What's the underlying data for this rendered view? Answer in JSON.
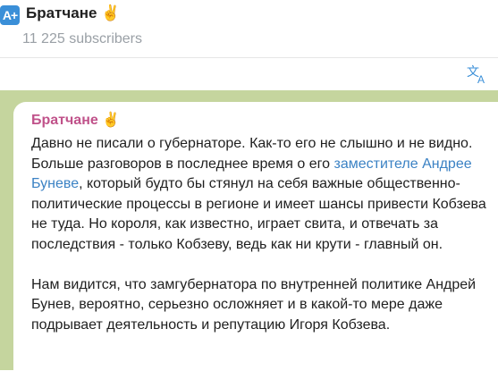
{
  "header": {
    "avatar_text": "A+",
    "channel_title": "Братчане",
    "title_emoji": "✌️",
    "subscribers": "11 225 subscribers"
  },
  "toolbar": {
    "translate_icon": "translate-icon"
  },
  "message": {
    "sender": "Братчане",
    "sender_emoji": "✌️",
    "p1_before_link": "Давно не писали о губернаторе. Как-то его не слышно и не видно. Больше разговоров в последнее время о его ",
    "p1_link": "заместителе Андрее Буневе",
    "p1_after_link": ", который будто бы стянул на себя важные общественно-политические процессы в регионе и имеет шансы привести Кобзева не туда. Но короля, как известно, играет свита, и отвечать за последствия - только Кобзеву, ведь как ни крути - главный он.",
    "p2": "Нам видится, что замгубернатора по внутренней политике Андрей Бунев, вероятно, серьезно осложняет и в какой-то мере даже подрывает деятельность и репутацию Игоря Кобзева."
  },
  "colors": {
    "accent": "#3a8fd8",
    "sender": "#c0528a",
    "link": "#3b82c4",
    "chat_background": "#c5d59e"
  }
}
